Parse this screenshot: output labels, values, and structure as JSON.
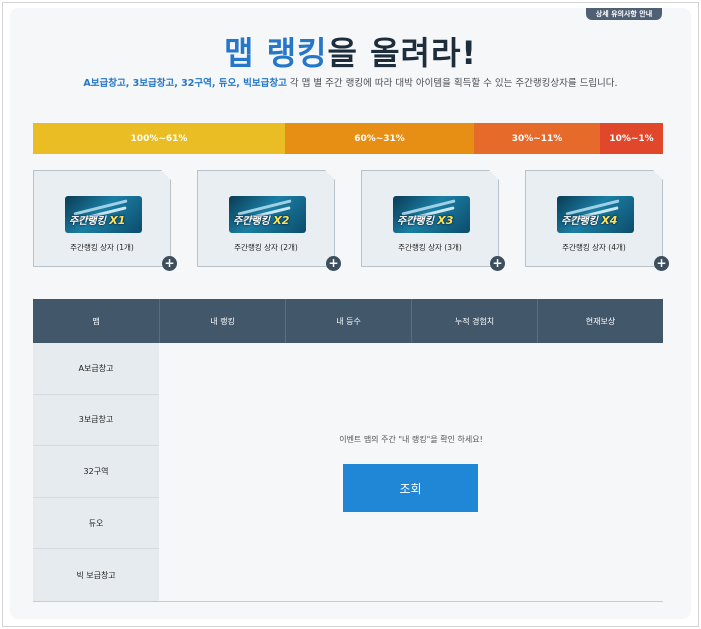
{
  "header": {
    "notice_label": "상세 유의사항 안내",
    "title_highlight": "맵 랭킹",
    "title_rest": "을 올려라!",
    "subtitle_maps": "A보급창고, 3보급창고, 32구역, 듀오, 빅보급창고",
    "subtitle_rest": " 각 맵 별 주간 랭킹에 따라 대박 아이템을 획득할 수 있는 주간랭킹상자를 드립니다."
  },
  "tiers": [
    {
      "label": "100%~61%",
      "color": "#ebbd24"
    },
    {
      "label": "60%~31%",
      "color": "#e78e14"
    },
    {
      "label": "30%~11%",
      "color": "#e66a2a"
    },
    {
      "label": "10%~1%",
      "color": "#e0472b"
    }
  ],
  "rewards": [
    {
      "tag": "주간랭킹",
      "multiplier": "X1",
      "label": "주간랭킹 상자 (1개)"
    },
    {
      "tag": "주간랭킹",
      "multiplier": "X2",
      "label": "주간랭킹 상자 (2개)"
    },
    {
      "tag": "주간랭킹",
      "multiplier": "X3",
      "label": "주간랭킹 상자 (3개)"
    },
    {
      "tag": "주간랭킹",
      "multiplier": "X4",
      "label": "주간랭킹 상자 (4개)"
    }
  ],
  "table": {
    "columns": [
      "맵",
      "내 랭킹",
      "내 등수",
      "누적 경험치",
      "현재보상"
    ],
    "maps": [
      "A보급창고",
      "3보급창고",
      "32구역",
      "듀오",
      "빅 보급창고"
    ],
    "message": "이벤트 맵의 주간 \"내 랭킹\"을 확인 하세요!",
    "query_label": "조회"
  },
  "colors": {
    "accent": "#2577c9",
    "table_header": "#42576a",
    "button": "#1f87d6"
  }
}
